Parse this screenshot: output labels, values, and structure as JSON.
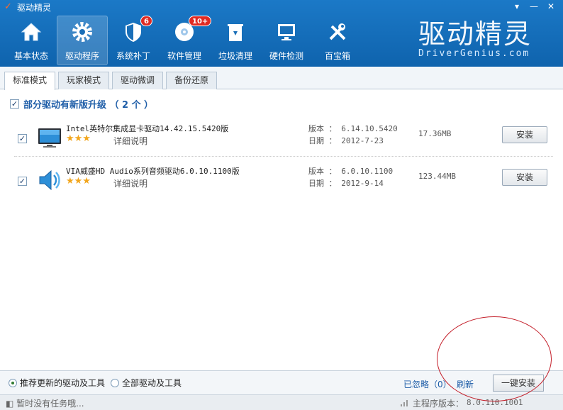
{
  "app": {
    "title": "驱动精灵",
    "window_buttons": [
      "▾",
      "—",
      "✕"
    ]
  },
  "nav": {
    "items": [
      {
        "label": "基本状态",
        "icon": "home-icon"
      },
      {
        "label": "驱动程序",
        "icon": "gear-icon",
        "active": true
      },
      {
        "label": "系统补丁",
        "icon": "shield-icon",
        "badge": "6"
      },
      {
        "label": "软件管理",
        "icon": "disc-icon",
        "badge": "10+"
      },
      {
        "label": "垃圾清理",
        "icon": "recycle-bin-icon"
      },
      {
        "label": "硬件检测",
        "icon": "monitor-icon"
      },
      {
        "label": "百宝箱",
        "icon": "tools-icon"
      }
    ]
  },
  "brand": {
    "cn": "驱动精灵",
    "en": "DriverGenius.com"
  },
  "tabs": [
    "标准模式",
    "玩家模式",
    "驱动微调",
    "备份还原"
  ],
  "section": {
    "title": "部分驱动有新版升级 （ 2 个 ）"
  },
  "drivers": [
    {
      "name": "Intel英特尔集成显卡驱动14.42.15.5420版",
      "stars": "★★★",
      "detail": "详细说明",
      "version": "版本 ： 6.14.10.5420",
      "date": "日期 ： 2012-7-23",
      "size": "17.36MB",
      "button": "安装",
      "icon": "display-adapter-icon"
    },
    {
      "name": "VIA威盛HD Audio系列音频驱动6.0.10.1100版",
      "stars": "★★★",
      "detail": "详细说明",
      "version": "版本 ： 6.0.10.1100",
      "date": "日期 ： 2012-9-14",
      "size": "123.44MB",
      "button": "安装",
      "icon": "speaker-icon"
    }
  ],
  "bottom": {
    "options": [
      "推荐更新的驱动及工具",
      "全部驱动及工具"
    ],
    "ignored": "已忽略（0）",
    "refresh": "刷新",
    "one_click": "一键安装"
  },
  "status": {
    "left": "暂时没有任务哦...",
    "right_label": "主程序版本：",
    "version": "8.0.110.1001"
  },
  "colors": {
    "toolbar": "#1b79c7",
    "accent": "#ff6a2a",
    "link": "#1f5ea8",
    "annotation": "#c41f2a"
  }
}
